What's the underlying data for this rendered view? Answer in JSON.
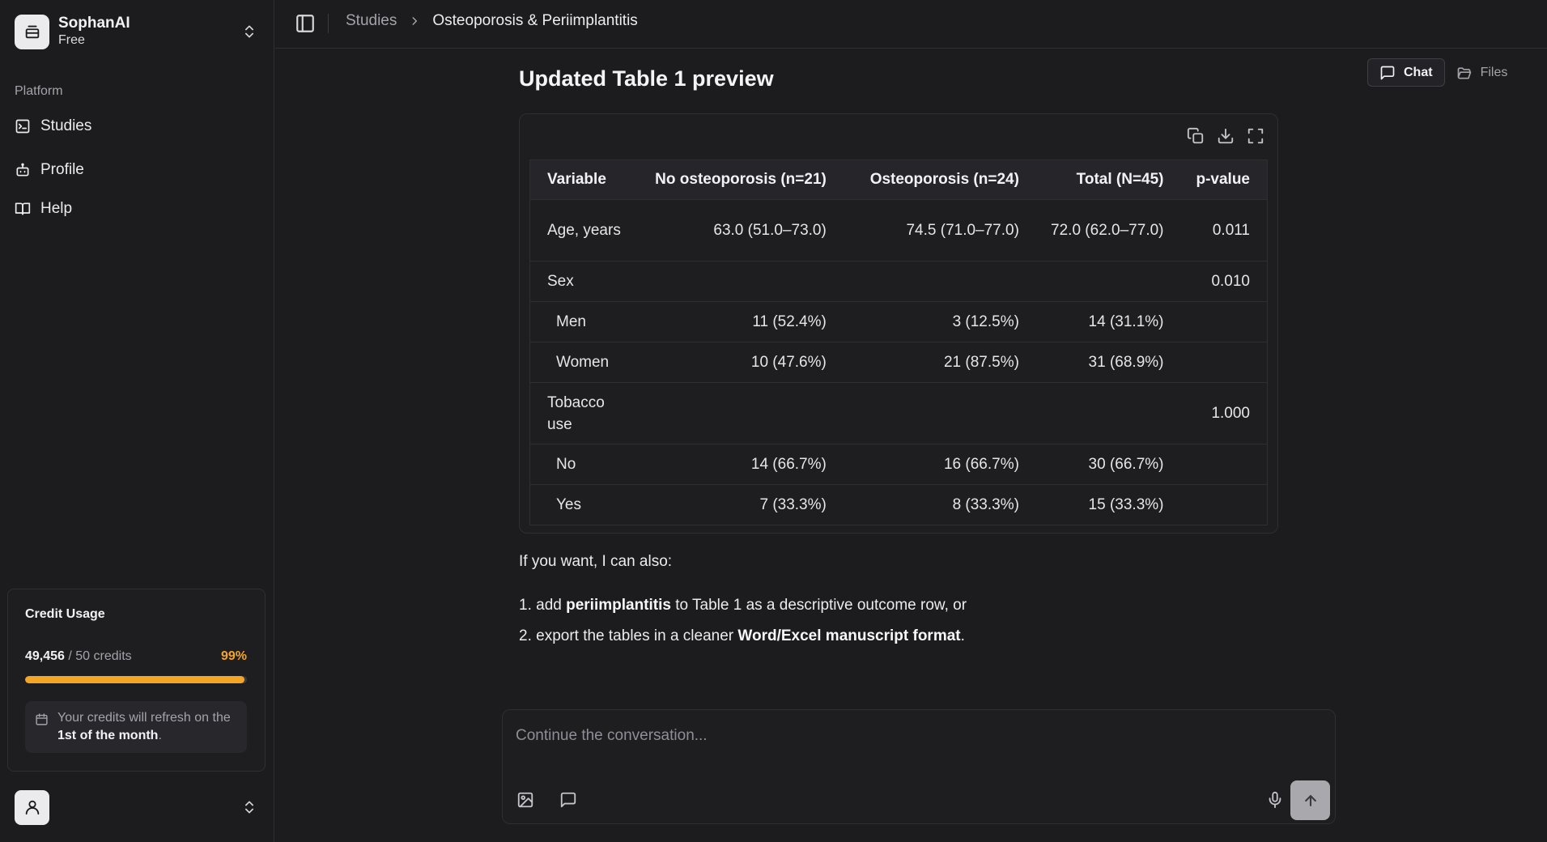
{
  "workspace": {
    "name": "SophanAI",
    "plan": "Free"
  },
  "sidebar": {
    "group_label": "Platform",
    "items": [
      {
        "label": "Studies",
        "icon": "studies-icon"
      },
      {
        "label": "Profile",
        "icon": "bot-icon"
      },
      {
        "label": "Help",
        "icon": "book-icon"
      }
    ]
  },
  "credits": {
    "title": "Credit Usage",
    "used": "49,456",
    "total_text": " / 50 credits",
    "percent_label": "99%",
    "percent_fill": 0.99,
    "refresh_text": "Your credits will refresh on the ",
    "refresh_date": "1st of the month",
    "refresh_end": "."
  },
  "breadcrumb": {
    "parent": "Studies",
    "current": "Osteoporosis & Periimplantitis"
  },
  "view_switch": {
    "chat": "Chat",
    "files": "Files"
  },
  "content": {
    "title": "Updated Table 1 preview",
    "table": {
      "headers": [
        "Variable",
        "No osteoporosis (n=21)",
        "Osteoporosis (n=24)",
        "Total (N=45)",
        "p-value"
      ],
      "rows": [
        [
          "Age, years",
          "63.0 (51.0–73.0)",
          "74.5 (71.0–77.0)",
          "72.0 (62.0–77.0)",
          "0.011"
        ],
        [
          "Sex",
          "",
          "",
          "",
          "0.010"
        ],
        [
          "Men",
          "11 (52.4%)",
          "3 (12.5%)",
          "14 (31.1%)",
          ""
        ],
        [
          "Women",
          "10 (47.6%)",
          "21 (87.5%)",
          "31 (68.9%)",
          ""
        ],
        [
          "Tobacco use",
          "",
          "",
          "",
          "1.000"
        ],
        [
          "No",
          "14 (66.7%)",
          "16 (66.7%)",
          "30 (66.7%)",
          ""
        ],
        [
          "Yes",
          "7 (33.3%)",
          "8 (33.3%)",
          "15 (33.3%)",
          ""
        ]
      ]
    },
    "followup_intro": "If you want, I can also:",
    "options": [
      {
        "num": "1. ",
        "pre": "add ",
        "bold": "periimplantitis",
        "post": " to Table 1 as a descriptive outcome row, or"
      },
      {
        "num": "2. ",
        "pre": "export the tables in a cleaner ",
        "bold": "Word/Excel manuscript format",
        "post": "."
      }
    ]
  },
  "composer": {
    "placeholder": "Continue the conversation..."
  },
  "colors": {
    "accent": "#f5a524",
    "background": "#1c1c1f",
    "panel": "#1e1e21",
    "border": "#2e2e33"
  }
}
